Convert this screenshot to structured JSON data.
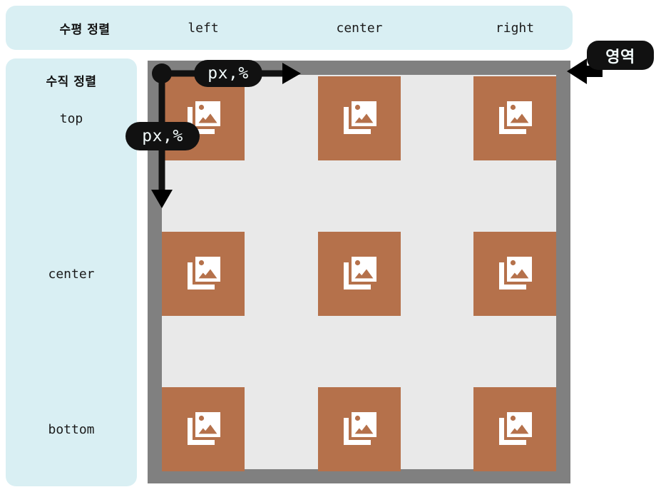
{
  "header": {
    "title": "수평 정렬",
    "columns": [
      {
        "label": "left"
      },
      {
        "label": "center"
      },
      {
        "label": "right"
      }
    ]
  },
  "sidebar": {
    "title": "수직 정렬",
    "rows": [
      {
        "label": "top"
      },
      {
        "label": "center"
      },
      {
        "label": "bottom"
      }
    ]
  },
  "annotations": {
    "horizontal_offset": "px,%",
    "vertical_offset": "px,%",
    "area": "영역"
  },
  "diagram": {
    "tile_icon": "images-stack-icon",
    "tiles": [
      {
        "row": "top",
        "col": "left"
      },
      {
        "row": "top",
        "col": "center"
      },
      {
        "row": "top",
        "col": "right"
      },
      {
        "row": "center",
        "col": "left"
      },
      {
        "row": "center",
        "col": "center"
      },
      {
        "row": "center",
        "col": "right"
      },
      {
        "row": "bottom",
        "col": "left"
      },
      {
        "row": "bottom",
        "col": "center"
      },
      {
        "row": "bottom",
        "col": "right"
      }
    ]
  },
  "colors": {
    "legend_background": "#d9eff3",
    "area_border": "#808080",
    "area_fill": "#e9e9e9",
    "tile": "#b5714b",
    "badge": "#111111",
    "icon": "#ffffff",
    "page_background": "#ffffff"
  }
}
